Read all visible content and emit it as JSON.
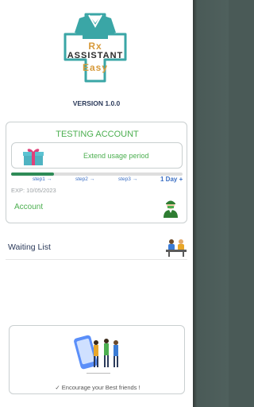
{
  "logo": {
    "line1": "Rx",
    "line2": "ASSISTANT",
    "line3": "Easy"
  },
  "version": "VERSION 1.0.0",
  "account_card": {
    "title": "TESTING ACCOUNT",
    "extend_label": "Extend usage period",
    "progress": 0.25,
    "steps": [
      "step1 →",
      "step2 →",
      "step3 →"
    ],
    "day_plus": "1 Day +",
    "exp": "EXP: 10/05/2023",
    "account_label": "Account"
  },
  "menu": {
    "waiting_list": "Waiting List"
  },
  "invite": {
    "label": "✓ Encourage your Best friends !"
  },
  "colors": {
    "accent": "#4caf50",
    "step": "#3b6fc4",
    "progress": "#2e8b57",
    "teal": "#3aa6a6"
  },
  "icons": [
    "gift-icon",
    "doctor-avatar-icon",
    "waiting-people-icon",
    "friends-illustration"
  ]
}
